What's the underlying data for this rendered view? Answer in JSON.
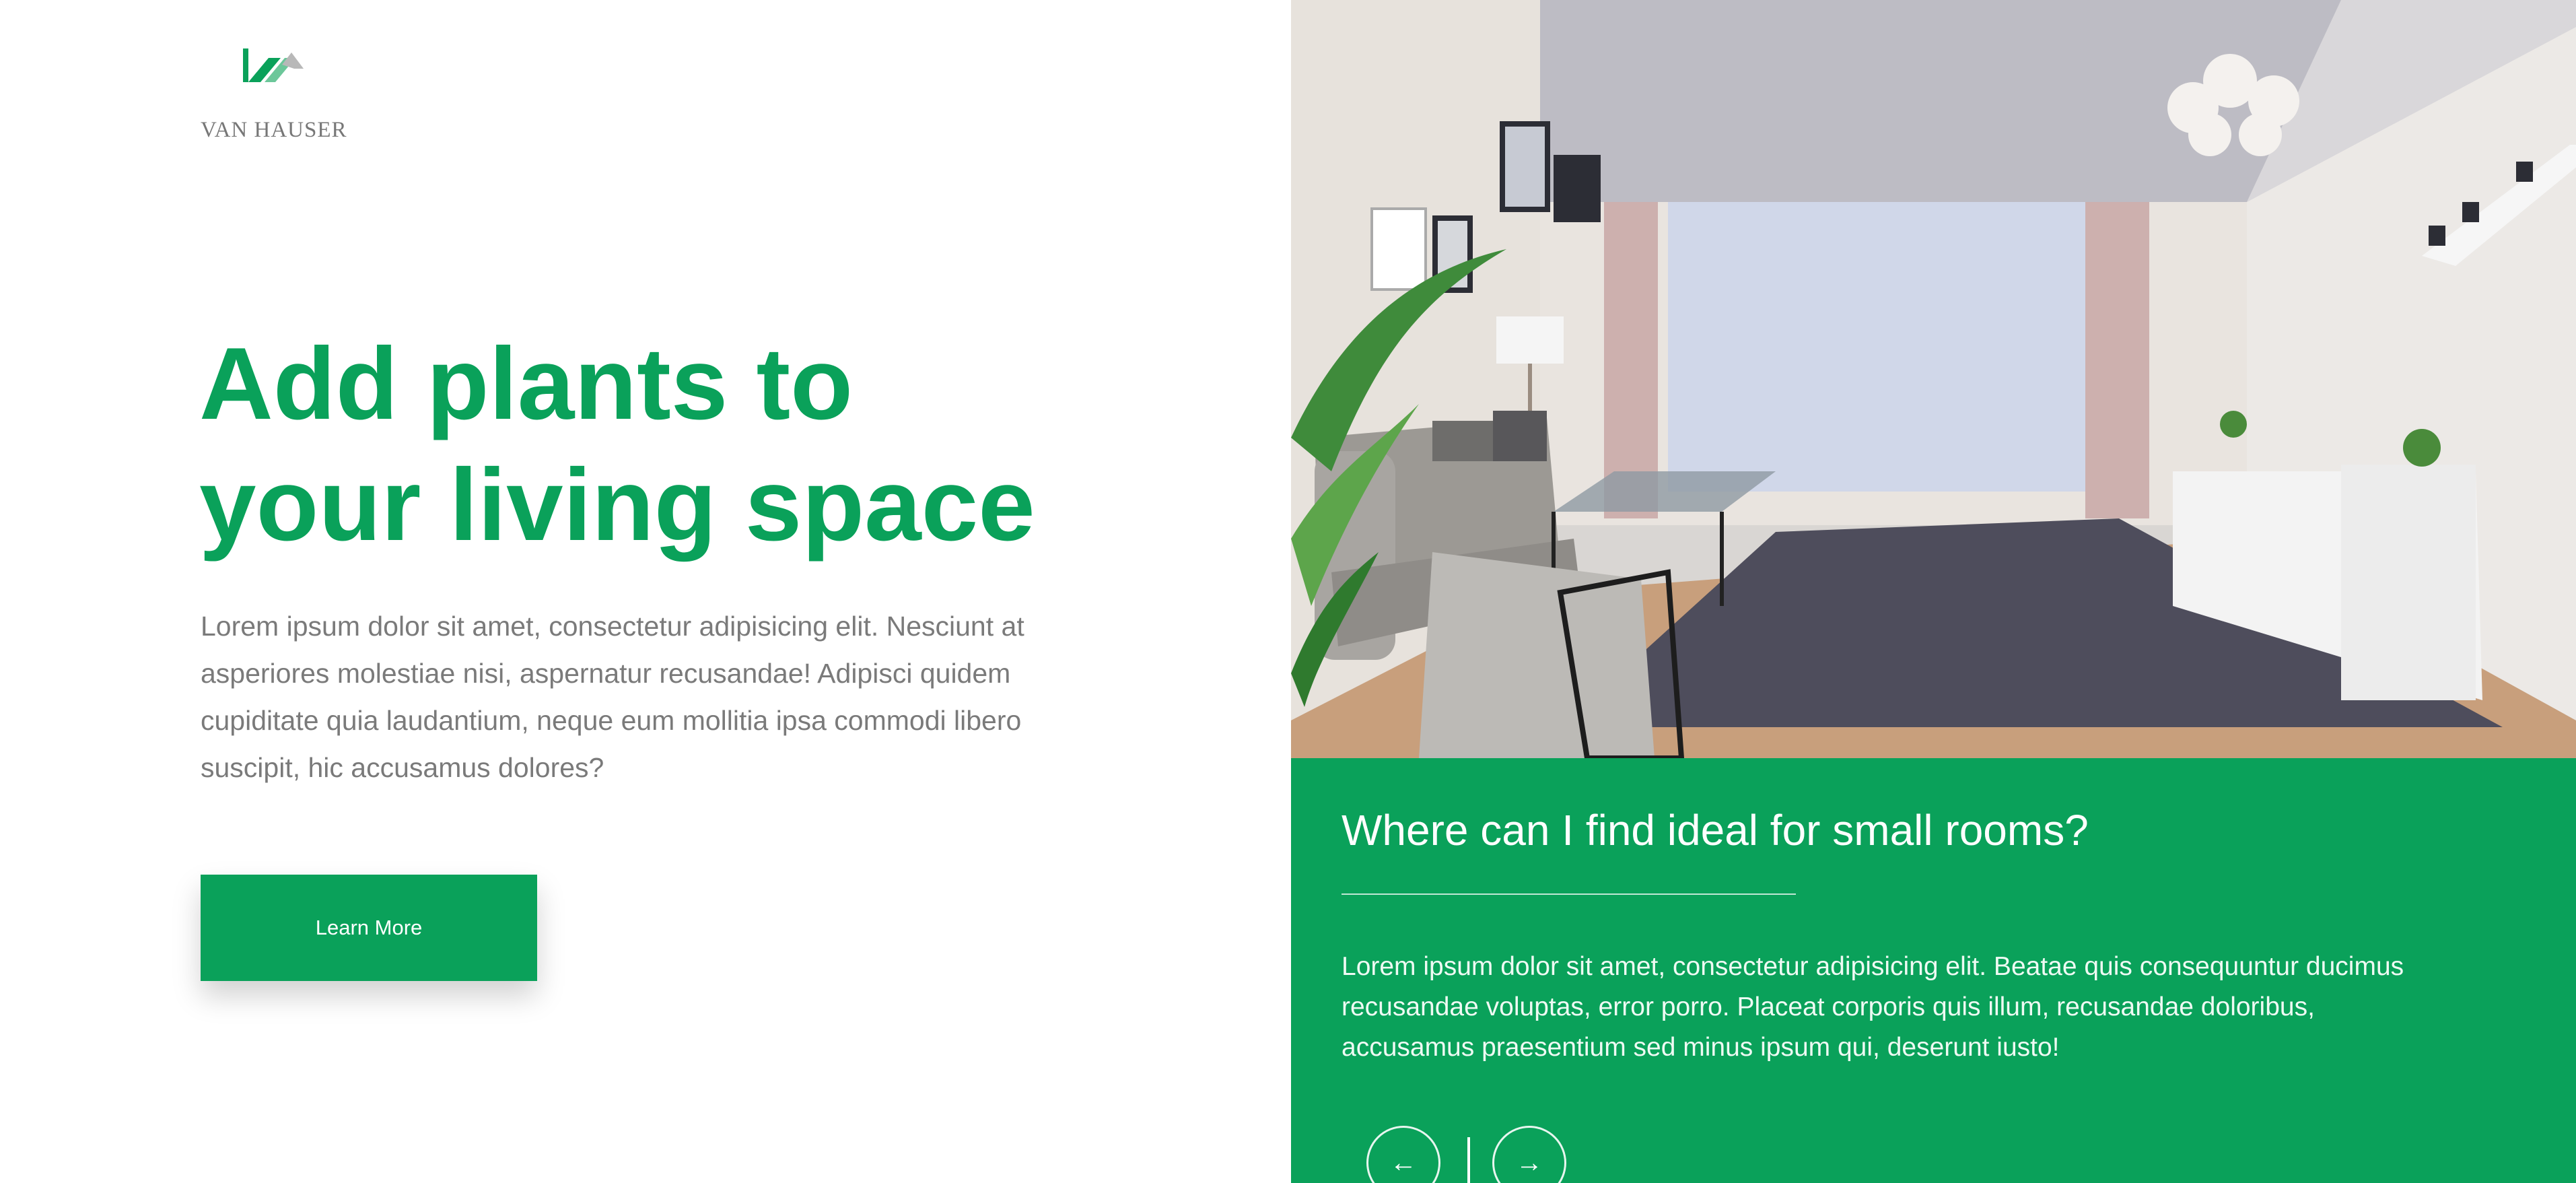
{
  "brand": {
    "name": "VAN HAUSER",
    "icon": "van-hauser-logo",
    "accent_color": "#0aa15a"
  },
  "hero": {
    "title_line1": "Add plants to",
    "title_line2": "your living space",
    "text": "Lorem ipsum dolor sit amet, consectetur adipisicing elit. Nesciunt at asperiores molestiae nisi, aspernatur recusandae! Adipisci quidem cupiditate quia laudantium, neque eum mollitia ipsa commodi libero suscipit, hic accusamus dolores?",
    "cta_label": "Learn More"
  },
  "photo": {
    "subject": "living room interior with sofa, rug, plant and shelves"
  },
  "info": {
    "title": "Where can I find ideal for small rooms?",
    "text": "Lorem ipsum dolor sit amet, consectetur adipisicing elit. Beatae quis consequuntur ducimus recusandae voluptas, error porro. Placeat corporis quis illum, recusandae doloribus, accusamus praesentium sed minus ipsum qui, deserunt iusto!",
    "prev_icon": "arrow-left-icon",
    "next_icon": "arrow-right-icon",
    "prev_glyph": "←",
    "next_glyph": "→"
  }
}
